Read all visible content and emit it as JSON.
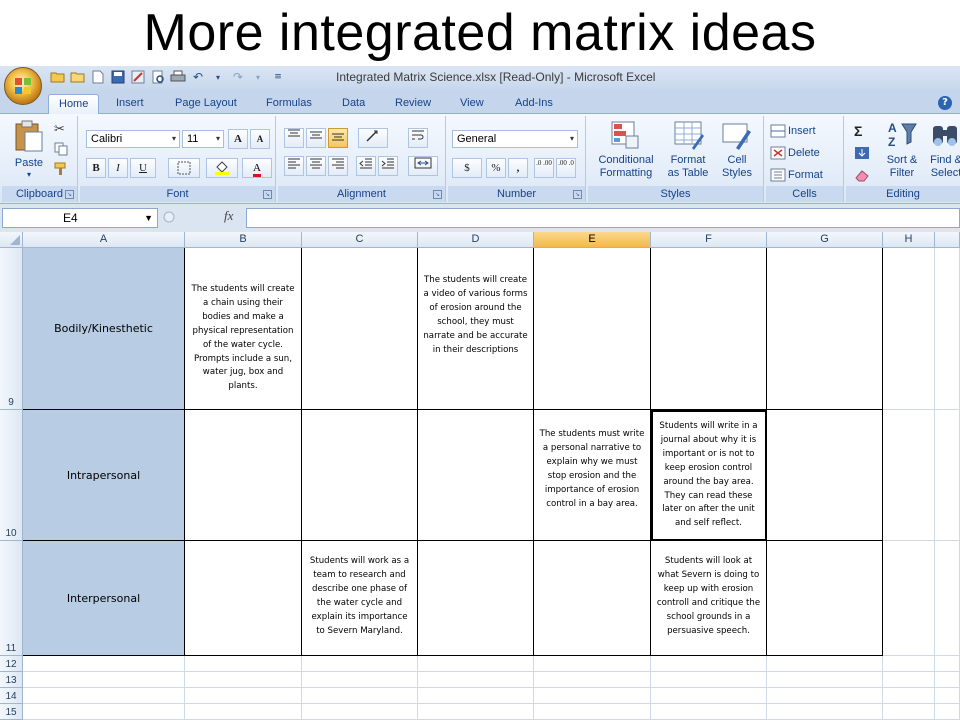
{
  "slide": {
    "title": "More integrated matrix ideas"
  },
  "window": {
    "title": "Integrated Matrix Science.xlsx  [Read-Only]  -  Microsoft Excel"
  },
  "tabs": [
    "Home",
    "Insert",
    "Page Layout",
    "Formulas",
    "Data",
    "Review",
    "View",
    "Add-Ins"
  ],
  "active_tab": "Home",
  "ribbon": {
    "clipboard": {
      "paste": "Paste",
      "label": "Clipboard"
    },
    "font": {
      "name": "Calibri",
      "size": "11",
      "label": "Font",
      "bold": "B",
      "italic": "I",
      "underline": "U",
      "grow": "A",
      "shrink": "A",
      "color_a": "A"
    },
    "alignment": {
      "label": "Alignment"
    },
    "number": {
      "format": "General",
      "label": "Number",
      "currency": "$",
      "percent": "%",
      "comma": ",",
      "inc_decimal": ".0 .00",
      "dec_decimal": ".00 .0"
    },
    "styles": {
      "label": "Styles",
      "conditional": "Conditional",
      "conditional2": "Formatting",
      "format_table": "Format",
      "format_table2": "as Table",
      "cell_styles": "Cell",
      "cell_styles2": "Styles"
    },
    "cells": {
      "label": "Cells",
      "insert": "Insert",
      "delete": "Delete",
      "format": "Format"
    },
    "editing": {
      "label": "Editing",
      "sort": "Sort &",
      "sort2": "Filter",
      "find": "Find &",
      "find2": "Select",
      "sigma": "Σ"
    }
  },
  "formula_bar": {
    "name_box": "E4",
    "fx": "fx",
    "value": ""
  },
  "columns": [
    "A",
    "B",
    "C",
    "D",
    "E",
    "F",
    "G",
    "H"
  ],
  "selected_column": "E",
  "rows": [
    {
      "number": "9",
      "label": "Bodily/Kinesthetic",
      "cells": {
        "B": "The students will create a chain using their bodies and make a physical representation of the water cycle. Prompts include a sun, water jug, box and plants.",
        "D": "The students will create a video of various forms of erosion around the school, they must narrate and be accurate in their descriptions"
      }
    },
    {
      "number": "10",
      "label": "Intrapersonal",
      "cells": {
        "E": "The students must write a personal narrative to explain why we must stop erosion and the importance of erosion control in a bay area.",
        "F": "Students will write in a journal about why it is important or is not to keep erosion control around the bay area. They can read these later on after the unit and self reflect."
      }
    },
    {
      "number": "11",
      "label": "Interpersonal",
      "cells": {
        "C": "Students will work as a team to research and describe one phase of the water cycle and explain its importance to Severn Maryland.",
        "F": "Students will look at what Severn is doing to keep up with erosion controll and critique the school grounds in a persuasive speech."
      }
    }
  ],
  "empty_rows": [
    "12",
    "13",
    "14",
    "15"
  ]
}
